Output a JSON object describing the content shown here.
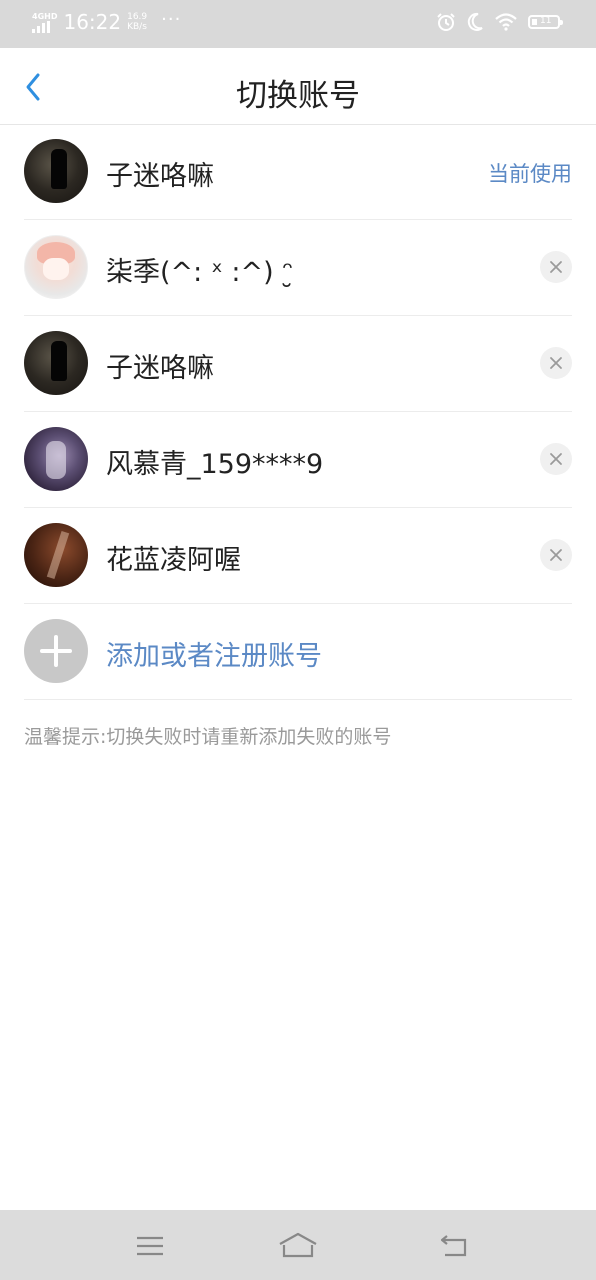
{
  "status_bar": {
    "network": "4GHD",
    "time": "16:22",
    "speed_value": "16.9",
    "speed_unit": "KB/s",
    "more": "···",
    "battery_text": "11"
  },
  "header": {
    "title": "切换账号",
    "back_icon": "chevron-left-icon",
    "accent_color": "#2f8fe0"
  },
  "accounts": [
    {
      "name": "子迷咯嘛",
      "status": "当前使用",
      "avatar": "dark-figure"
    },
    {
      "name": "柒季(^: ˣ :^) ᵔ̮",
      "avatar": "anime-girl"
    },
    {
      "name": "子迷咯嘛",
      "avatar": "dark-figure"
    },
    {
      "name": "风慕青_159****9",
      "avatar": "purple-figure"
    },
    {
      "name": "花蓝凌阿喔",
      "avatar": "red-figure"
    }
  ],
  "add_account": {
    "label": "添加或者注册账号",
    "icon": "plus-icon"
  },
  "hint": "温馨提示:切换失败时请重新添加失败的账号",
  "colors": {
    "link": "#5b89c5",
    "status_bar_bg": "#d9d9d9",
    "nav_bar_bg": "#dcdcdc"
  }
}
